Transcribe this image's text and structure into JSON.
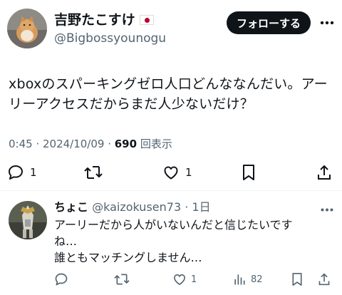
{
  "tweet": {
    "display_name": "吉野たこすけ",
    "handle": "@Bigbossyounogu",
    "follow_label": "フォローする",
    "text_line1": "xboxのスパーキングゼロ人口どんななんだい。アー",
    "text_line2": "リーアクセスだからまだ人少ないだけ？",
    "meta_time": "0:45 · 2024/10/09 · ",
    "views_count": "690",
    "views_label": " 回表示",
    "reply_count": "1",
    "retweet_count": "",
    "like_count": "1"
  },
  "reply": {
    "display_name": "ちょこ",
    "handle_time": "@kaizokusen73 · 1日",
    "text_line1": "アーリーだから人がいないんだと信じたいです",
    "text_line2": "ね…",
    "text_line3": "誰ともマッチングしません…",
    "reply_count": "",
    "retweet_count": "",
    "like_count": "1",
    "views_count": "82"
  },
  "colors": {
    "text": "#0f1419",
    "secondary": "#536471",
    "follow_bg": "#0f1419",
    "divider": "#eff3f4"
  }
}
